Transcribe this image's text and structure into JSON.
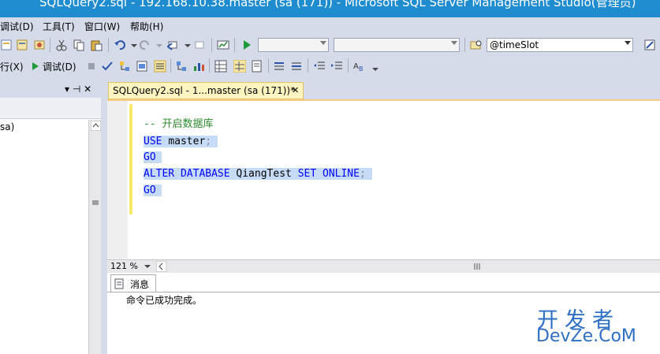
{
  "window": {
    "title": "SQLQuery2.sql - 192.168.10.38.master (sa (171)) - Microsoft SQL Server Management Studio(管理员)"
  },
  "menu": [
    {
      "label": "调试(D)"
    },
    {
      "label": "工具(T)"
    },
    {
      "label": "窗口(W)"
    },
    {
      "label": "帮助(H)"
    }
  ],
  "toolbar": {
    "parameter_combo_value": "@timeSlot",
    "execute_label": "行(X)",
    "debug_label": "调试(D)"
  },
  "left_panel": {
    "pin_glyph": "▾ ⊣ ✕",
    "tree_item": "sa)"
  },
  "editor_tab": {
    "label": "SQLQuery2.sql - 1...master (sa (171))*",
    "close_glyph": "✕"
  },
  "code": {
    "comment": "-- 开启数据库",
    "line2_kw": "USE",
    "line2_id": "master",
    "line2_semi": ";",
    "line3_kw": "GO",
    "line4_kw1": "ALTER DATABASE",
    "line4_id": "QiangTest",
    "line4_kw2": "SET ONLINE",
    "line4_semi": ";",
    "line5_kw": "GO"
  },
  "zoom": {
    "value": "121 %"
  },
  "results": {
    "tab_label": "消息",
    "message": "命令已成功完成。"
  },
  "watermark": {
    "line1": "开发者",
    "line2": "DevZe.CoM"
  },
  "colors": {
    "title_bar": "#1e8ccf",
    "chrome": "#d6dbe9",
    "selection": "#c6dcf6",
    "keyword": "#0000ff",
    "comment": "#2e8b2e",
    "watermark": "#2d6fc4"
  }
}
